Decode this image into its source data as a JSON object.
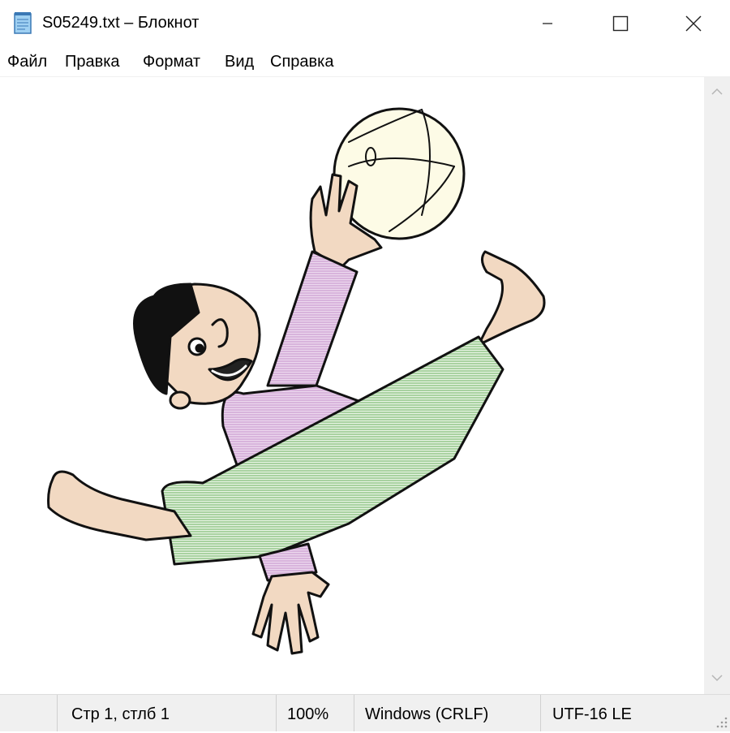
{
  "window": {
    "title": "S05249.txt – Блокнот",
    "controls": [
      "minimize-icon",
      "maximize-icon",
      "close-icon"
    ]
  },
  "menu": {
    "items": [
      "Файл",
      "Правка",
      "Формат",
      "Вид",
      "Справка"
    ]
  },
  "editor": {
    "content_type": "clipart",
    "content_description_icon": "volleyball-player-illustration"
  },
  "status": {
    "position": "Стр 1, стлб 1",
    "zoom": "100%",
    "line_ending": "Windows (CRLF)",
    "encoding": "UTF-16 LE"
  },
  "colors": {
    "shirt": "#d8b4dc",
    "pants": "#a9d2a1",
    "skin": "#f2d9c2",
    "ball": "#fdfbe6",
    "hair": "#111111"
  }
}
